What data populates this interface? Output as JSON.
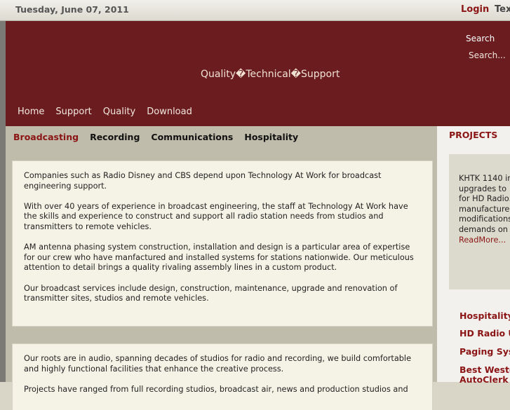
{
  "topbar": {
    "date": "Tuesday, June 07, 2011",
    "login": "Login",
    "text_size": "Text"
  },
  "banner": {
    "slogan": "Quality�Technical�Support",
    "search_label": "Search",
    "search_placeholder": "Search..."
  },
  "main_nav": [
    "Home",
    "Support",
    "Quality",
    "Download"
  ],
  "sub_nav": [
    {
      "label": "Broadcasting",
      "active": true
    },
    {
      "label": "Recording",
      "active": false
    },
    {
      "label": "Communications",
      "active": false
    },
    {
      "label": "Hospitality",
      "active": false
    }
  ],
  "box1": {
    "paragraphs": [
      "Companies such as Radio Disney and CBS depend upon Technology At Work for broadcast engineering support.",
      "With over 40 years of experience in broadcast engineering, the staff at Technology At Work have the skills and experience to construct and support all radio station needs from studios and transmitters to remote vehicles.",
      "AM antenna phasing system construction, installation and design is a particular area of expertise for our crew who have manfactured and installed systems for stations nationwide.  Our meticulous attention to detail brings a quality rivaling assembly lines in a custom product.",
      "Our broadcast services include design, construction, maintenance, upgrade and renovation of transmitter sites, studios and remote vehicles."
    ]
  },
  "box2": {
    "paragraphs": [
      "Our roots are in audio, spanning decades of studios for radio and recording, we build comfortable and highly functional facilities that enhance the creative process.",
      "Projects have ranged from full recording studios, broadcast air, news and production studios and"
    ]
  },
  "projects": {
    "title": "PROJECTS",
    "lines": [
      "KHTK 1140 in",
      "upgrades to",
      "for HD Radio.",
      "manufacture",
      "modifications",
      "demands on"
    ],
    "read_more": "ReadMore...",
    "links": [
      "Hospitality",
      "HD Radio U",
      "Paging Sys",
      "Best Weste",
      "AutoClerk"
    ]
  },
  "colors": {
    "accent": "#8b1515",
    "banner": "#6b1c1f",
    "content_bg": "#bfbcab",
    "box_bg": "#f5f3e6"
  }
}
